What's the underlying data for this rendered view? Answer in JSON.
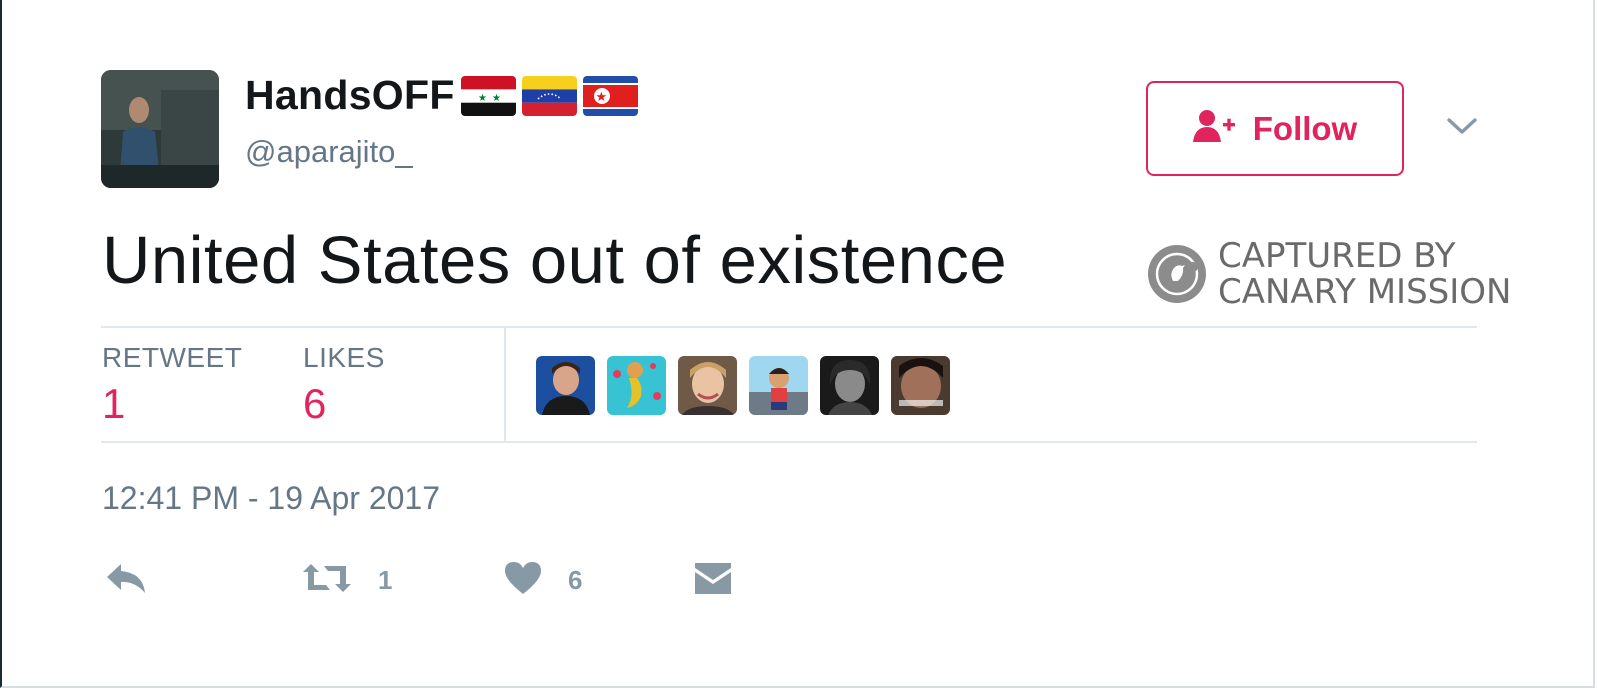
{
  "user": {
    "display_name": "HandsOFF",
    "handle": "@aparajito_",
    "flags": [
      "syria-flag",
      "venezuela-flag",
      "north-korea-flag"
    ]
  },
  "follow_button": {
    "label": "Follow",
    "icon": "add-user-icon"
  },
  "menu": {
    "icon": "chevron-down-icon"
  },
  "tweet": {
    "text": "United States out of existence"
  },
  "watermark": {
    "line1": "CAPTURED BY",
    "line2": "CANARY MISSION"
  },
  "stats": {
    "retweets": {
      "label": "RETWEET",
      "count": "1"
    },
    "likes": {
      "label": "LIKES",
      "count": "6"
    }
  },
  "likers": [
    "liker-avatar-1",
    "liker-avatar-2",
    "liker-avatar-3",
    "liker-avatar-4",
    "liker-avatar-5",
    "liker-avatar-6"
  ],
  "timestamp": "12:41 PM - 19 Apr 2017",
  "actions": {
    "reply": {
      "icon": "reply-icon"
    },
    "retweet": {
      "icon": "retweet-icon",
      "count": "1"
    },
    "like": {
      "icon": "heart-icon",
      "count": "6"
    },
    "dm": {
      "icon": "envelope-icon"
    }
  },
  "colors": {
    "accent": "#e0245e",
    "text": "#14171a",
    "muted": "#657786",
    "icon": "#8899a6",
    "divider": "#e1e8ed"
  }
}
